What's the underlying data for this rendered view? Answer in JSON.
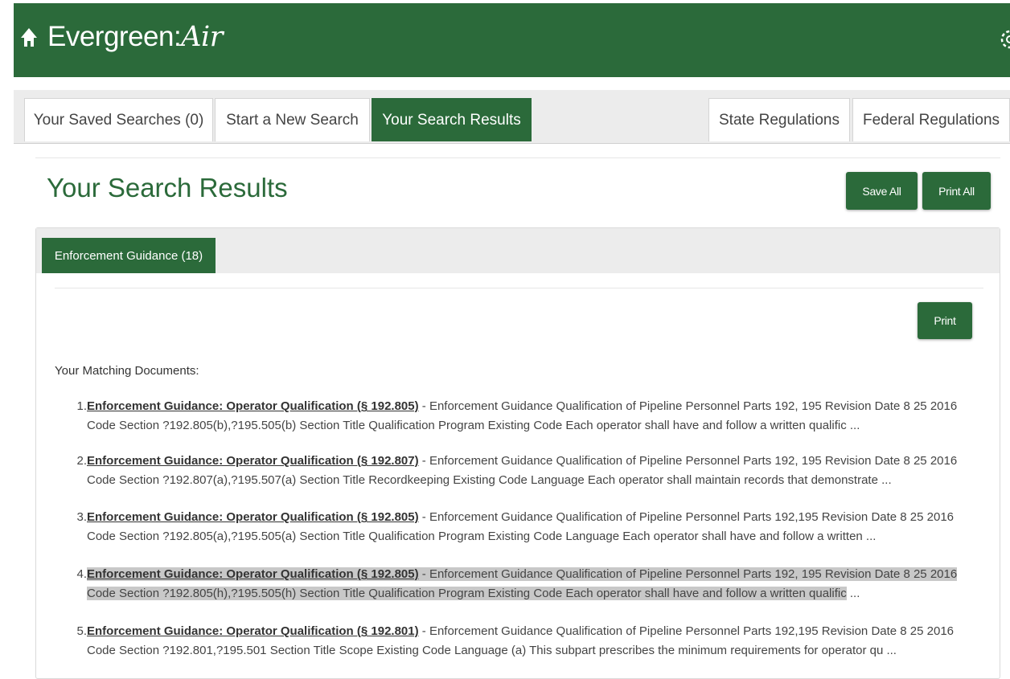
{
  "header": {
    "brand_main": "Evergreen:",
    "brand_script": "Air",
    "bg_color": "#2b6a3a"
  },
  "tabs": [
    {
      "label": "Your Saved Searches (0)",
      "active": false
    },
    {
      "label": "Start a New Search",
      "active": false
    },
    {
      "label": "Your Search Results",
      "active": true
    },
    {
      "label": "State Regulations",
      "active": false
    },
    {
      "label": "Federal Regulations",
      "active": false
    }
  ],
  "page": {
    "title": "Your Search Results",
    "save_all_label": "Save All",
    "print_all_label": "Print All"
  },
  "panel": {
    "subtab_label": "Enforcement Guidance (18)",
    "print_label": "Print",
    "matching_label": "Your Matching Documents:"
  },
  "results": [
    {
      "num": "1.",
      "title": "Enforcement Guidance: Operator Qualification (§ 192.805)",
      "line1_rest": " - Enforcement Guidance Qualification of Pipeline Personnel Parts 192, 195 Revision Date 8 25 2016",
      "line2": "Code Section ?192.805(b),?195.505(b) Section Title Qualification Program Existing Code Each operator shall have and follow a written qualific ...",
      "highlighted": false
    },
    {
      "num": "2.",
      "title": "Enforcement Guidance: Operator Qualification (§ 192.807)",
      "line1_rest": " - Enforcement Guidance Qualification of Pipeline Personnel Parts 192, 195 Revision Date 8 25 2016",
      "line2": "Code Section ?192.807(a),?195.507(a) Section Title Recordkeeping Existing Code Language Each operator shall maintain records that demonstrate ...",
      "highlighted": false
    },
    {
      "num": "3.",
      "title": "Enforcement Guidance: Operator Qualification (§ 192.805)",
      "line1_rest": " - Enforcement Guidance Qualification of Pipeline Personnel Parts 192,195 Revision Date 8 25 2016",
      "line2": "Code Section ?192.805(a),?195.505(a) Section Title Qualification Program Existing Code Language Each operator shall have and follow a written ...",
      "highlighted": false
    },
    {
      "num": "4.",
      "title": "Enforcement Guidance: Operator Qualification (§ 192.805)",
      "line1_rest": " - Enforcement Guidance Qualification of Pipeline Personnel Parts 192, 195 Revision Date 8 25 2016",
      "line2_hl": "Code Section ?192.805(h),?195.505(h) Section Title Qualification Program Existing Code Each operator shall have and follow a written qualific",
      "line2_tail": " ...",
      "highlighted": true
    },
    {
      "num": "5.",
      "title": "Enforcement Guidance: Operator Qualification (§ 192.801)",
      "line1_rest": " - Enforcement Guidance Qualification of Pipeline Personnel Parts 192,195 Revision Date 8 25 2016",
      "line2": "Code Section ?192.801,?195.501 Section Title Scope Existing Code Language (a) This subpart prescribes the minimum requirements for operator qu ...",
      "highlighted": false
    }
  ]
}
